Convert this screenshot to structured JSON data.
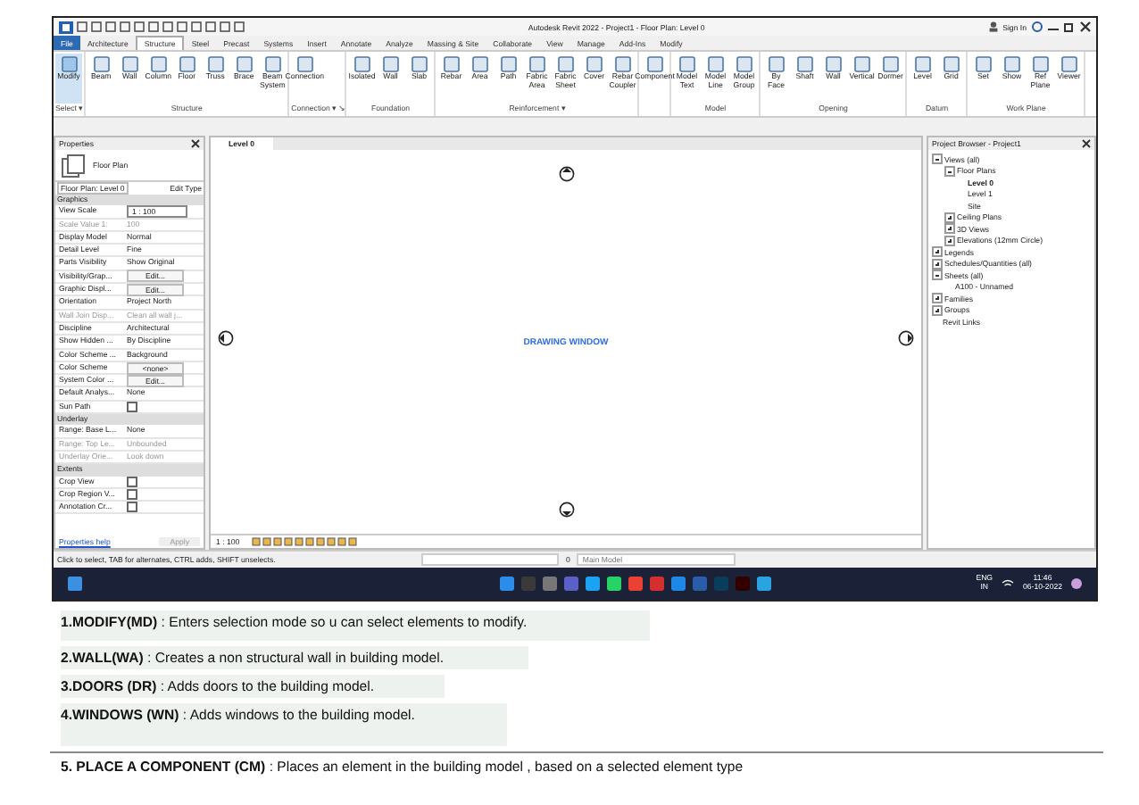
{
  "window": {
    "title": "Autodesk Revit 2022 - Project1 - Floor Plan: Level 0",
    "sign_in": "Sign In"
  },
  "tabs": [
    {
      "label": "File",
      "selected": false,
      "kind": "file"
    },
    {
      "label": "Architecture",
      "selected": false
    },
    {
      "label": "Structure",
      "selected": true
    },
    {
      "label": "Steel",
      "selected": false
    },
    {
      "label": "Precast",
      "selected": false
    },
    {
      "label": "Systems",
      "selected": false
    },
    {
      "label": "Insert",
      "selected": false
    },
    {
      "label": "Annotate",
      "selected": false
    },
    {
      "label": "Analyze",
      "selected": false
    },
    {
      "label": "Massing & Site",
      "selected": false
    },
    {
      "label": "Collaborate",
      "selected": false
    },
    {
      "label": "View",
      "selected": false
    },
    {
      "label": "Manage",
      "selected": false
    },
    {
      "label": "Add-Ins",
      "selected": false
    },
    {
      "label": "Modify",
      "selected": false
    }
  ],
  "ribbon": [
    {
      "label": "Select ▾",
      "tools": [
        {
          "label": "Modify",
          "selected": true
        }
      ]
    },
    {
      "label": "Structure",
      "tools": [
        {
          "label": "Beam",
          "selected": false
        },
        {
          "label": "Wall",
          "selected": false
        },
        {
          "label": "Column",
          "selected": false
        },
        {
          "label": "Floor",
          "selected": false
        },
        {
          "label": "Truss",
          "selected": false
        },
        {
          "label": "Brace",
          "selected": false
        },
        {
          "label": "Beam System",
          "selected": false
        }
      ]
    },
    {
      "label": "Connection ▾ ↘",
      "tools": [
        {
          "label": "Connection",
          "selected": false
        }
      ]
    },
    {
      "label": "Foundation",
      "tools": [
        {
          "label": "Isolated",
          "selected": false
        },
        {
          "label": "Wall",
          "selected": false
        },
        {
          "label": "Slab",
          "selected": false
        }
      ]
    },
    {
      "label": "Reinforcement ▾",
      "tools": [
        {
          "label": "Rebar",
          "selected": false
        },
        {
          "label": "Area",
          "selected": false
        },
        {
          "label": "Path",
          "selected": false
        },
        {
          "label": "Fabric Area",
          "selected": false
        },
        {
          "label": "Fabric Sheet",
          "selected": false
        },
        {
          "label": "Cover",
          "selected": false
        },
        {
          "label": "Rebar Coupler",
          "selected": false
        }
      ]
    },
    {
      "tools": [
        {
          "label": "Component",
          "selected": false
        }
      ]
    },
    {
      "label": "Model",
      "tools": [
        {
          "label": "Model Text",
          "selected": false
        },
        {
          "label": "Model Line",
          "selected": false
        },
        {
          "label": "Model Group",
          "selected": false
        }
      ]
    },
    {
      "label": "Opening",
      "tools": [
        {
          "label": "By Face",
          "selected": false
        },
        {
          "label": "Shaft",
          "selected": false
        },
        {
          "label": "Wall",
          "selected": false
        },
        {
          "label": "Vertical",
          "selected": false
        },
        {
          "label": "Dormer",
          "selected": false
        }
      ]
    },
    {
      "label": "Datum",
      "tools": [
        {
          "label": "Level",
          "selected": false
        },
        {
          "label": "Grid",
          "selected": false
        }
      ]
    },
    {
      "label": "Work Plane",
      "tools": [
        {
          "label": "Set",
          "selected": false
        },
        {
          "label": "Show",
          "selected": false
        },
        {
          "label": "Ref Plane",
          "selected": false
        },
        {
          "label": "Viewer",
          "selected": false
        }
      ]
    }
  ],
  "properties": {
    "title": "Properties",
    "type_name": "Floor Plan",
    "selector": "Floor Plan: Level 0",
    "edit_type": "Edit Type",
    "groups": [
      {
        "label": "Graphics",
        "rows": [
          {
            "name": "View Scale",
            "value": "1 : 100",
            "kind": "field",
            "disabled": false
          },
          {
            "name": "Scale Value    1:",
            "value": "100",
            "kind": "text",
            "disabled": true
          },
          {
            "name": "Display Model",
            "value": "Normal",
            "kind": "text",
            "disabled": false
          },
          {
            "name": "Detail Level",
            "value": "Fine",
            "kind": "text",
            "disabled": false
          },
          {
            "name": "Parts Visibility",
            "value": "Show Original",
            "kind": "text",
            "disabled": false
          },
          {
            "name": "Visibility/Grap...",
            "value": "Edit...",
            "kind": "button",
            "disabled": false
          },
          {
            "name": "Graphic Displ...",
            "value": "Edit...",
            "kind": "button",
            "disabled": false
          },
          {
            "name": "Orientation",
            "value": "Project North",
            "kind": "text",
            "disabled": false
          },
          {
            "name": "Wall Join Disp...",
            "value": "Clean all wall j...",
            "kind": "text",
            "disabled": true
          },
          {
            "name": "Discipline",
            "value": "Architectural",
            "kind": "text",
            "disabled": false
          },
          {
            "name": "Show Hidden ...",
            "value": "By Discipline",
            "kind": "text",
            "disabled": false
          },
          {
            "name": "Color Scheme ...",
            "value": "Background",
            "kind": "text",
            "disabled": false
          },
          {
            "name": "Color Scheme",
            "value": "<none>",
            "kind": "button",
            "disabled": false
          },
          {
            "name": "System Color ...",
            "value": "Edit...",
            "kind": "button",
            "disabled": false
          },
          {
            "name": "Default Analys...",
            "value": "None",
            "kind": "text",
            "disabled": false
          },
          {
            "name": "Sun Path",
            "kind": "check",
            "checked": false,
            "disabled": false
          }
        ]
      },
      {
        "label": "Underlay",
        "rows": [
          {
            "name": "Range: Base L...",
            "value": "None",
            "kind": "text",
            "disabled": false
          },
          {
            "name": "Range: Top Le...",
            "value": "Unbounded",
            "kind": "text",
            "disabled": true
          },
          {
            "name": "Underlay Orie...",
            "value": "Look down",
            "kind": "text",
            "disabled": true
          }
        ]
      },
      {
        "label": "Extents",
        "rows": [
          {
            "name": "Crop View",
            "kind": "check",
            "checked": false,
            "disabled": false
          },
          {
            "name": "Crop Region V...",
            "kind": "check",
            "checked": false,
            "disabled": false
          },
          {
            "name": "Annotation Cr...",
            "kind": "check",
            "checked": false,
            "disabled": false
          }
        ]
      }
    ],
    "help_link": "Properties help",
    "apply": "Apply"
  },
  "view": {
    "tab": "Level 0",
    "label": "DRAWING WINDOW",
    "scale": "1 : 100"
  },
  "browser": {
    "title": "Project Browser - Project1",
    "tree": [
      {
        "label": "Views (all)",
        "expanded": true,
        "selected": false,
        "children": [
          {
            "label": "Floor Plans",
            "expanded": true,
            "selected": false,
            "children": [
              {
                "label": "Level 0",
                "selected": true
              },
              {
                "label": "Level 1",
                "selected": false
              },
              {
                "label": "Site",
                "selected": false
              }
            ]
          },
          {
            "label": "Ceiling Plans",
            "expanded": false,
            "selected": false
          },
          {
            "label": "3D Views",
            "expanded": false,
            "selected": false
          },
          {
            "label": "Elevations (12mm Circle)",
            "expanded": false,
            "selected": false
          }
        ]
      },
      {
        "label": "Legends",
        "expanded": false,
        "selected": false
      },
      {
        "label": "Schedules/Quantities (all)",
        "expanded": false,
        "selected": false
      },
      {
        "label": "Sheets (all)",
        "expanded": true,
        "selected": false,
        "children": [
          {
            "label": "A100 - Unnamed",
            "selected": false
          }
        ]
      },
      {
        "label": "Families",
        "expanded": false,
        "selected": false
      },
      {
        "label": "Groups",
        "expanded": false,
        "selected": false
      },
      {
        "label": "Revit Links",
        "selected": false
      }
    ]
  },
  "status_bar": {
    "hint": "Click to select, TAB for alternates, CTRL adds, SHIFT unselects.",
    "count": "0",
    "model": "Main Model"
  },
  "taskbar": {
    "language": "ENG",
    "region": "IN",
    "time": "11:46",
    "date": "06-10-2022"
  },
  "notes": [
    "**1.MODIFY(MD)** : Enters selection mode so u can select elements to modify.",
    "**2.WALL(WA)** : Creates a non structural wall in building model.",
    "**3.DOORS (DR)** : Adds doors to the building model.",
    "**4.WINDOWS (WN)** : Adds windows to the building model.",
    "**5. PLACE A COMPONENT (CM)** : Places an element in the building model , based on a selected element type"
  ]
}
